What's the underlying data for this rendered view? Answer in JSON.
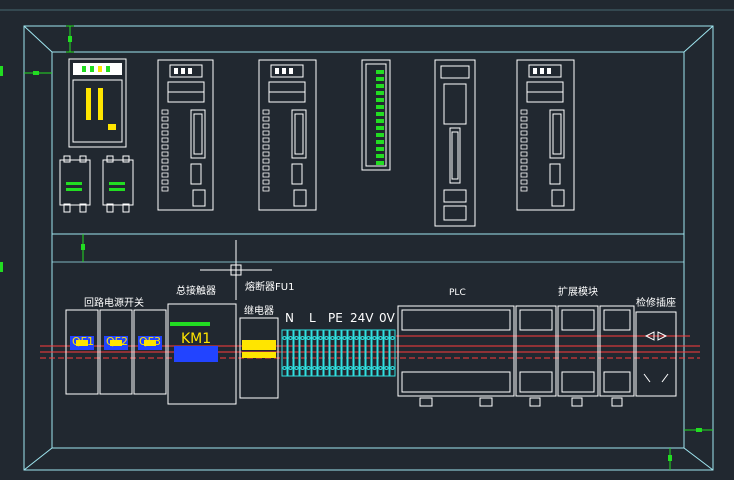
{
  "colors": {
    "background": "#212830",
    "cabinet_frame": "#9fe6f0",
    "device_outline": "#ffffff",
    "green_dimension": "#22dd22",
    "yellow_label": "#ffe500",
    "red_wire": "#ff3b3b",
    "blue_contactor": "#2244ff",
    "cyan_terminal": "#30e0e0"
  },
  "labels": {
    "loop_switch": "回路电源开关",
    "main_contactor": "总接触器",
    "fuse": "熔断器FU1",
    "relay": "继电器",
    "plc": "PLC",
    "expansion": "扩展模块",
    "service_socket": "检修插座",
    "qf1": "QF1",
    "qf2": "QF2",
    "qf3": "QF3",
    "km1": "KM1",
    "term_n": "N",
    "term_l": "L",
    "term_pe": "PE",
    "term_24v": "24V",
    "term_0v": "0V"
  },
  "top_devices": [
    {
      "name": "power-supply-module",
      "icon": "power-supply"
    },
    {
      "name": "servo-drive-1",
      "icon": "servo-drive"
    },
    {
      "name": "servo-drive-2",
      "icon": "servo-drive"
    },
    {
      "name": "io-module",
      "icon": "io-module"
    },
    {
      "name": "plc-cpu-tall",
      "icon": "plc-cpu"
    },
    {
      "name": "servo-drive-3",
      "icon": "servo-drive"
    }
  ]
}
